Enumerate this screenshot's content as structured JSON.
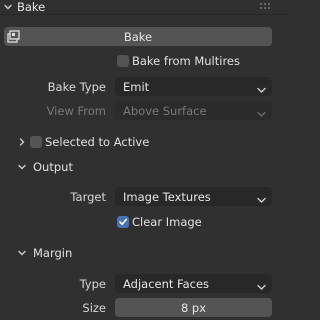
{
  "panel": {
    "title": "Bake"
  },
  "bake_button": {
    "label": "Bake"
  },
  "bake_from_multires": {
    "label": "Bake from Multires",
    "checked": false
  },
  "bake_type": {
    "label": "Bake Type",
    "value": "Emit"
  },
  "view_from": {
    "label": "View From",
    "value": "Above Surface"
  },
  "selected_to_active": {
    "label": "Selected to Active",
    "checked": false,
    "expanded": false
  },
  "output": {
    "title": "Output",
    "target_label": "Target",
    "target_value": "Image Textures",
    "clear_image": {
      "label": "Clear Image",
      "checked": true
    }
  },
  "margin": {
    "title": "Margin",
    "type_label": "Type",
    "type_value": "Adjacent Faces",
    "size_label": "Size",
    "size_value": "8 px"
  },
  "colors": {
    "background": "#303030",
    "field": "#282828",
    "button": "#545454",
    "accent": "#4772b3"
  }
}
